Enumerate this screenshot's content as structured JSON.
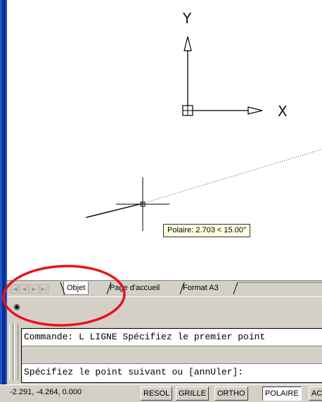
{
  "canvas": {
    "ucs_y_label": "Y",
    "ucs_x_label": "X",
    "tooltip": "Polaire: 2.703 < 15.00°"
  },
  "tabs": [
    {
      "label": "Objet",
      "active": true
    },
    {
      "label": "Page d'accueil",
      "active": false
    },
    {
      "label": "Format A3",
      "active": false
    }
  ],
  "toolbar": {
    "icon": "eye-icon",
    "glyph": "◉"
  },
  "command": {
    "history": "Commande: L LIGNE Spécifiez le premier point",
    "prompt": "Spécifiez le point suivant ou [annUler]:"
  },
  "status": {
    "coordinates": "-2.291, -4.264, 0.000",
    "buttons": [
      {
        "label": "RESOL",
        "pressed": false
      },
      {
        "label": "GRILLE",
        "pressed": false
      },
      {
        "label": "ORTHO",
        "pressed": false
      },
      {
        "label": "POLAIRE",
        "pressed": true
      },
      {
        "label": "AC",
        "pressed": false
      }
    ]
  },
  "colors": {
    "annotation_circle": "#e8141c",
    "frame_blue": "#2152c8",
    "panel_grey": "#d4d0c8",
    "tooltip_bg": "#ffffe1"
  }
}
